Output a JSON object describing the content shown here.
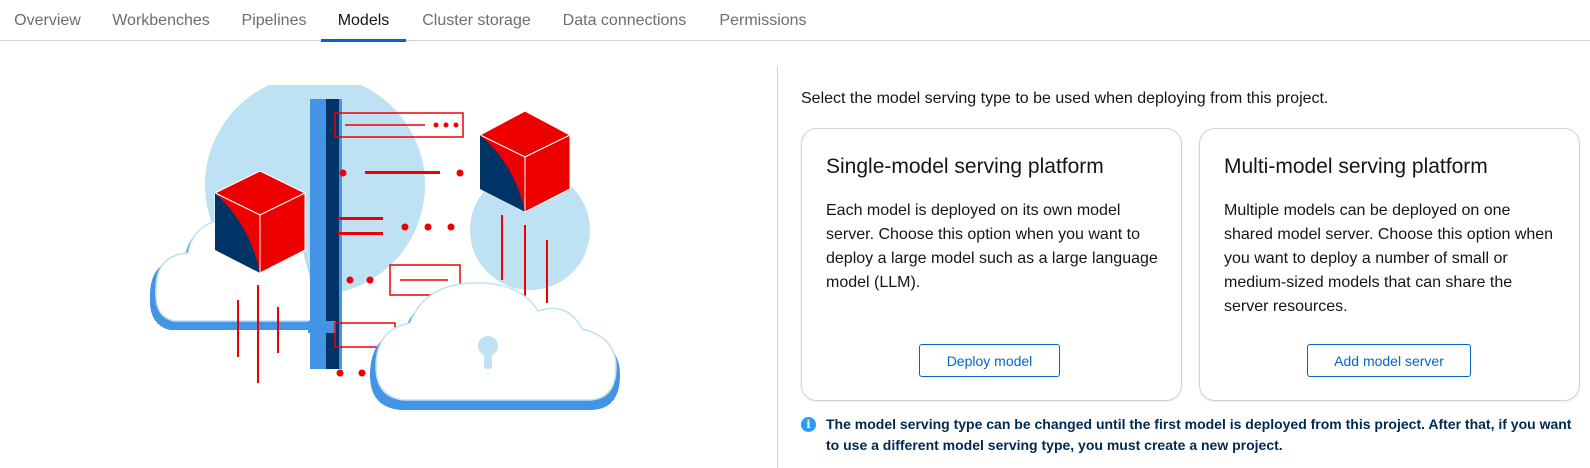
{
  "tabs": [
    {
      "label": "Overview"
    },
    {
      "label": "Workbenches"
    },
    {
      "label": "Pipelines"
    },
    {
      "label": "Models",
      "active": true
    },
    {
      "label": "Cluster storage"
    },
    {
      "label": "Data connections"
    },
    {
      "label": "Permissions"
    }
  ],
  "intro": "Select the model serving type to be used when deploying from this project.",
  "cards": [
    {
      "title": "Single-model serving platform",
      "body": "Each model is deployed on its own model server. Choose this option when you want to deploy a large model such as a large language model (LLM).",
      "button": "Deploy model"
    },
    {
      "title": "Multi-model serving platform",
      "body": "Multiple models can be deployed on one shared model server. Choose this option when you want to deploy a number of small or medium-sized models that can share the server resources.",
      "button": "Add model server"
    }
  ],
  "info": {
    "icon": "info-icon",
    "text": "The model serving type can be changed until the first model is deployed from this project. After that, if you want to use a different model serving type, you must create a new project."
  },
  "colors": {
    "accent": "#0066cc",
    "active_tab_underline": "#0066cc",
    "info_text": "#002952",
    "illustration_red": "#ee0000",
    "illustration_light_blue": "#bee1f4",
    "illustration_blue": "#4394e5",
    "illustration_navy": "#003366"
  }
}
